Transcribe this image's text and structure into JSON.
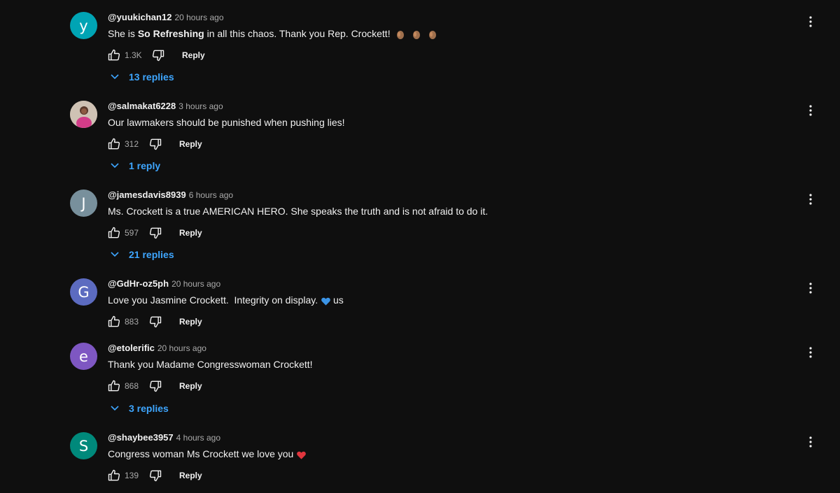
{
  "ui": {
    "reply_label": "Reply"
  },
  "comments": [
    {
      "author": "@yuukichan12",
      "time": "20 hours ago",
      "text_pre": "She is ",
      "text_bold": "So Refreshing",
      "text_post": " in all this chaos. Thank you Rep. Crockett!",
      "emoji": [
        "clapping-hands-icon",
        "clapping-hands-icon",
        "clapping-hands-icon"
      ],
      "likes": "1.3K",
      "replies": "13 replies",
      "avatar_letter": "y",
      "avatar_color": "#00a4b4"
    },
    {
      "author": "@salmakat6228",
      "time": "3 hours ago",
      "text_pre": "Our lawmakers should be punished when pushing lies!",
      "text_bold": "",
      "text_post": "",
      "likes": "312",
      "replies": "1 reply",
      "avatar_letter": "",
      "avatar_color": "#c9b9a6",
      "avatar_icon": "profile-photo-icon"
    },
    {
      "author": "@jamesdavis8939",
      "time": "6 hours ago",
      "text_pre": "Ms. Crockett is a true AMERICAN HERO. She speaks the truth and is not afraid to do it.",
      "text_bold": "",
      "text_post": "",
      "likes": "597",
      "replies": "21 replies",
      "avatar_letter": "J",
      "avatar_color": "#78909c"
    },
    {
      "author": "@GdHr-oz5ph",
      "time": "20 hours ago",
      "text_pre": "Love you Jasmine Crockett.  Integrity on display. ",
      "text_bold": "",
      "text_post": "us",
      "emoji_mid": "blue-heart-icon",
      "likes": "883",
      "replies": "",
      "avatar_letter": "G",
      "avatar_color": "#5c6bc0"
    },
    {
      "author": "@etolerific",
      "time": "20 hours ago",
      "text_pre": "Thank you Madame Congresswoman Crockett!",
      "text_bold": "",
      "text_post": "",
      "likes": "868",
      "replies": "3 replies",
      "avatar_letter": "e",
      "avatar_color": "#7e57c2"
    },
    {
      "author": "@shaybee3957",
      "time": "4 hours ago",
      "text_pre": "Congress woman Ms Crockett we love you ",
      "text_bold": "",
      "text_post": "",
      "emoji_end": "red-heart-icon",
      "likes": "139",
      "replies": "",
      "avatar_letter": "S",
      "avatar_color": "#00897b"
    }
  ]
}
